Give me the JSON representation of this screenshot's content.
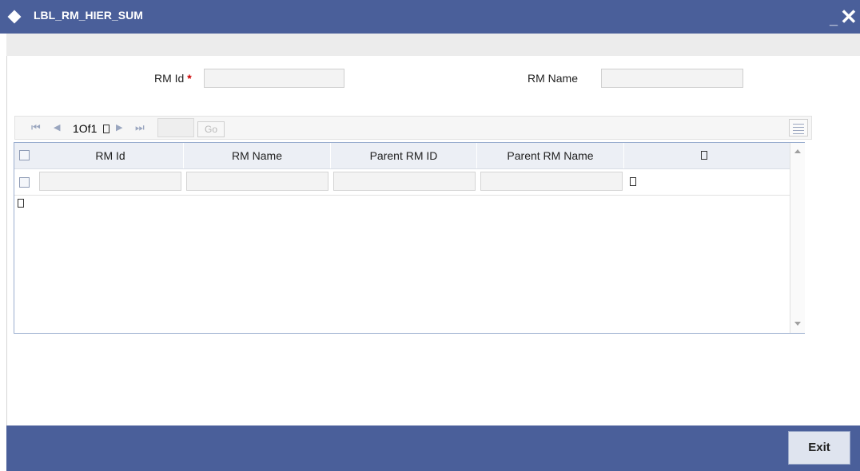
{
  "window": {
    "title": "LBL_RM_HIER_SUM",
    "minimize_glyph": "_",
    "close_glyph": "✕",
    "title_icon": "diamond-icon"
  },
  "form": {
    "rm_id_label": "RM Id",
    "required_marker": "*",
    "rm_id_value": "",
    "rm_name_label": "RM Name",
    "rm_name_value": ""
  },
  "pager": {
    "first_glyph": "⏮",
    "prev_glyph": "◀",
    "next_glyph": "▶",
    "last_glyph": "⏭",
    "page_text": "1Of1",
    "page_input_value": "",
    "go_label": "Go"
  },
  "table": {
    "columns": [
      "RM Id",
      "RM Name",
      "Parent RM ID",
      "Parent RM Name"
    ],
    "rows": [
      {
        "rm_id": "",
        "rm_name": "",
        "parent_rm_id": "",
        "parent_rm_name": ""
      }
    ]
  },
  "footer": {
    "exit_label": "Exit"
  },
  "colors": {
    "header_bar": "#4a5f9a",
    "required": "#cc0000"
  }
}
